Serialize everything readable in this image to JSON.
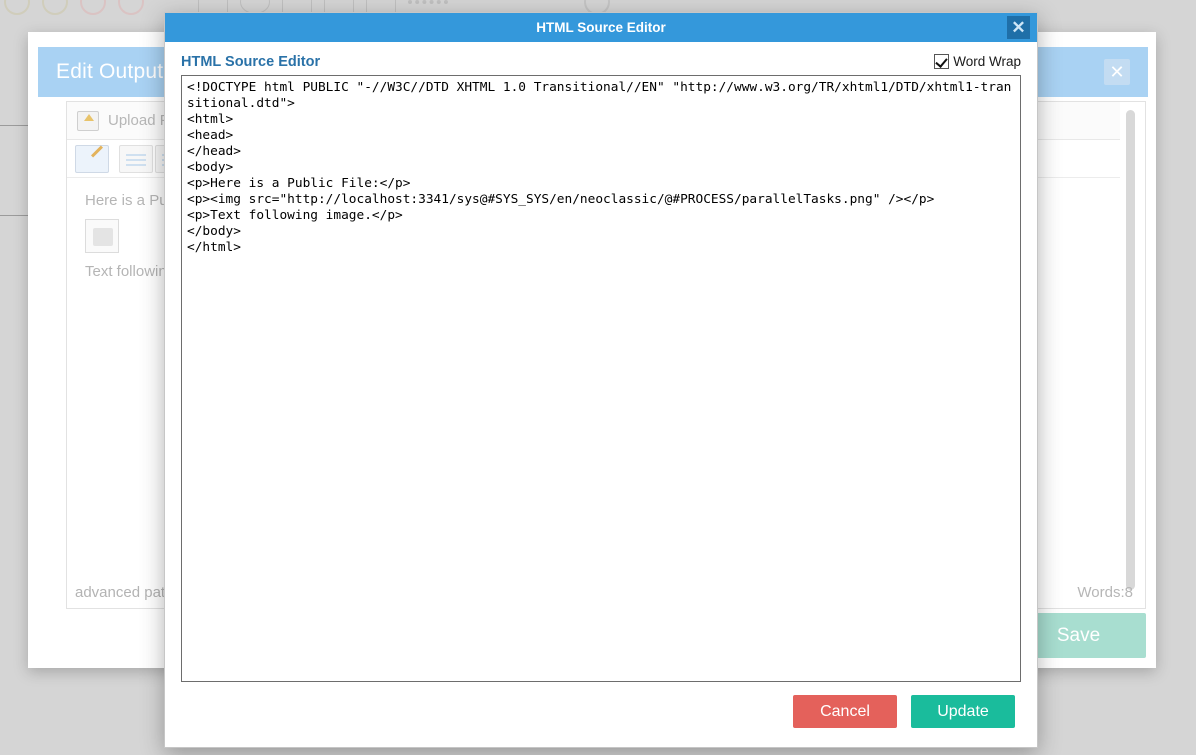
{
  "background": {
    "toolbar_icons": [
      "circle-stamp-icon",
      "circle-stamp-icon",
      "circle-red-icon",
      "circle-red-icon",
      "square-icon",
      "oval-icon",
      "box-split-icon",
      "box-split-icon",
      "box-bottom-icon",
      "dashed-line-icon",
      "text-cursor-icon",
      "help-icon",
      "refresh-icon"
    ],
    "dialog": {
      "title": "Edit Output D",
      "close_icon": "close-icon",
      "upload_label": "Upload File",
      "upload_icon": "upload-icon",
      "toolbar_buttons": [
        "edit-source-button",
        "table-button",
        "image-button"
      ],
      "body_line_1": "Here is a Public",
      "body_broken_image": "broken-image-icon",
      "body_line_2": "Text following im",
      "advanced_label": "advanced pat",
      "words_label": "Words:8",
      "save_label": "Save"
    }
  },
  "modal": {
    "titlebar": {
      "title": "HTML Source Editor",
      "close_icon": "close-icon"
    },
    "subtitle": "HTML Source Editor",
    "word_wrap": {
      "label": "Word Wrap",
      "checked": true
    },
    "editor": {
      "value": "<!DOCTYPE html PUBLIC \"-//W3C//DTD XHTML 1.0 Transitional//EN\" \"http://www.w3.org/TR/xhtml1/DTD/xhtml1-transitional.dtd\">\n<html>\n<head>\n</head>\n<body>\n<p>Here is a Public File:</p>\n<p><img src=\"http://localhost:3341/sys@#SYS_SYS/en/neoclassic/@#PROCESS/parallelTasks.png\" /></p>\n<p>Text following image.</p>\n</body>\n</html>",
      "placeholder": ""
    },
    "footer": {
      "cancel_label": "Cancel",
      "update_label": "Update"
    }
  },
  "colors": {
    "titlebar_blue": "#3498db",
    "subtitle_blue": "#2a72a8",
    "cancel_red": "#e4615b",
    "update_green": "#1abc9c",
    "bg_dialog_header": "#a9d2f3",
    "bg_save_green": "#a8ded0"
  }
}
